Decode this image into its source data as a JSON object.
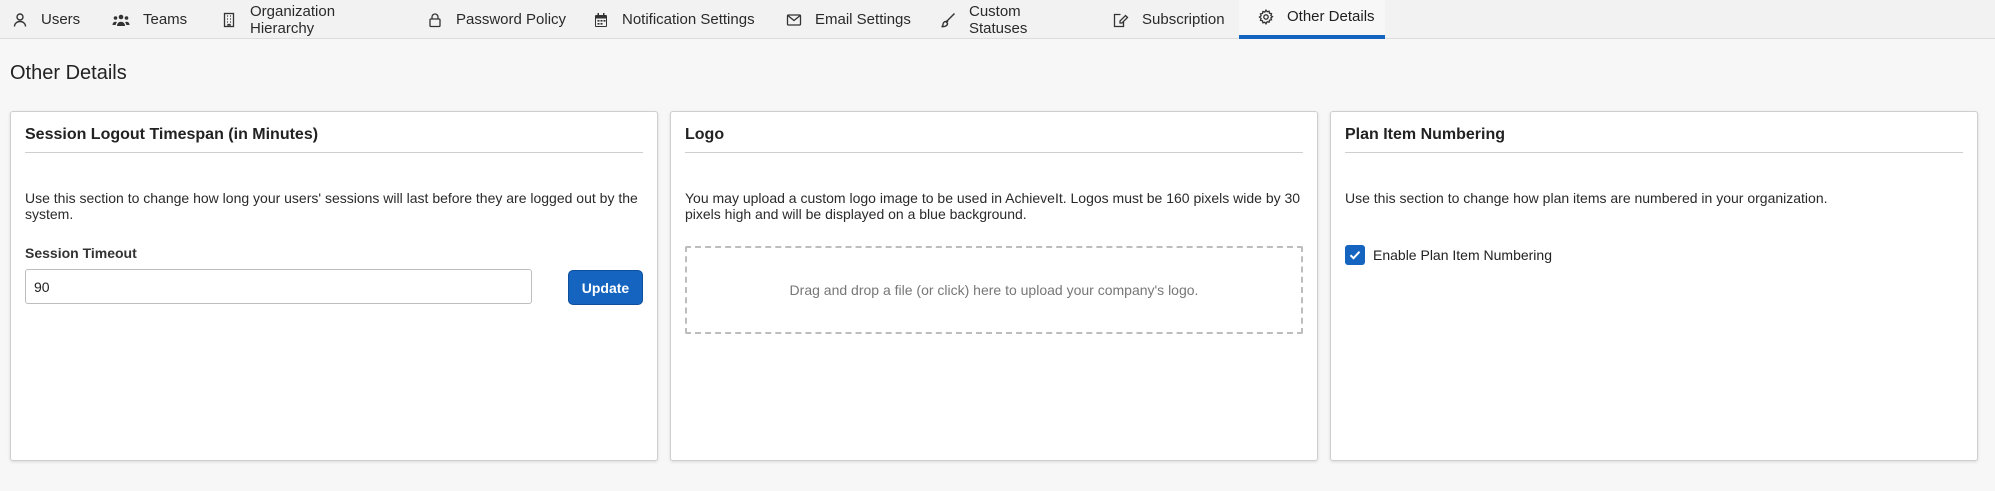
{
  "tabs": [
    {
      "label": "Users",
      "icon": "user-icon",
      "active": false
    },
    {
      "label": "Teams",
      "icon": "team-icon",
      "active": false
    },
    {
      "label": "Organization Hierarchy",
      "icon": "building-icon",
      "active": false
    },
    {
      "label": "Password Policy",
      "icon": "lock-icon",
      "active": false
    },
    {
      "label": "Notification Settings",
      "icon": "calendar-icon",
      "active": false
    },
    {
      "label": "Email Settings",
      "icon": "envelope-icon",
      "active": false
    },
    {
      "label": "Custom Statuses",
      "icon": "paintbrush-icon",
      "active": false
    },
    {
      "label": "Subscription",
      "icon": "edit-icon",
      "active": false
    },
    {
      "label": "Other Details",
      "icon": "gear-icon",
      "active": true
    }
  ],
  "page": {
    "title": "Other Details"
  },
  "session": {
    "title": "Session Logout Timespan (in Minutes)",
    "description": "Use this section to change how long your users' sessions will last before they are logged out by the system.",
    "field_label": "Session Timeout",
    "timeout_value": "90",
    "update_label": "Update"
  },
  "logo": {
    "title": "Logo",
    "description": "You may upload a custom logo image to be used in AchieveIt. Logos must be 160 pixels wide by 30 pixels high and will be displayed on a blue background.",
    "dropzone_text": "Drag and drop a file (or click) here to upload your company's logo."
  },
  "numbering": {
    "title": "Plan Item Numbering",
    "description": "Use this section to change how plan items are numbered in your organization.",
    "checkbox_label": "Enable Plan Item Numbering",
    "checked": true
  },
  "colors": {
    "accent": "#1565c0",
    "tabbar_bg": "#f2f2f2",
    "page_bg": "#f7f7f7"
  }
}
